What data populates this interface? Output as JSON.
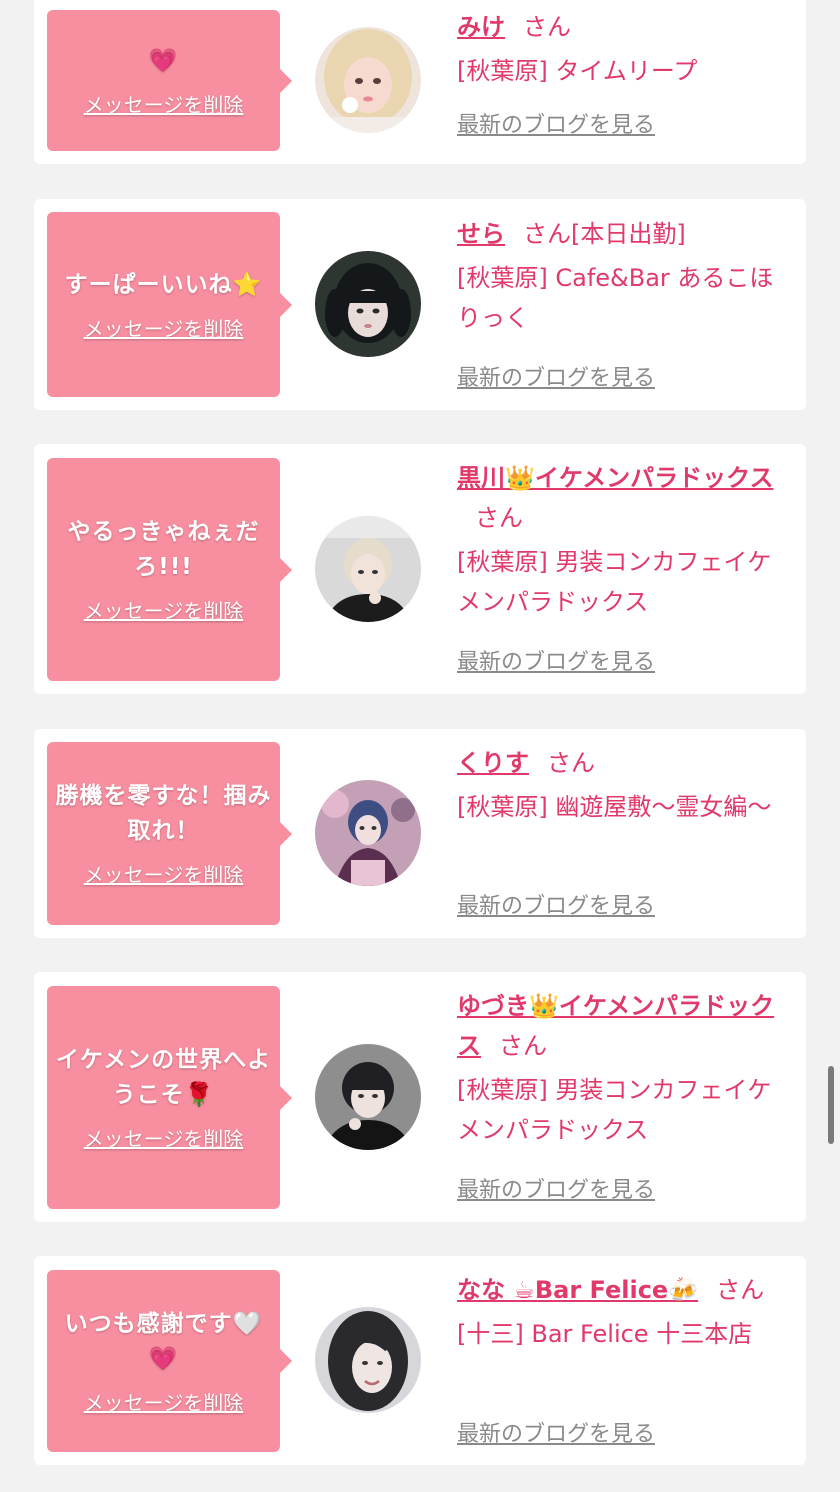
{
  "delete_label": "メッセージを削除",
  "blog_label": "最新のブログを見る",
  "san_label": "さん",
  "colors": {
    "accent": "#e0396a",
    "bubble": "#f88fa0",
    "link_gray": "#8a8a8a",
    "background": "#f2f2f3"
  },
  "items": [
    {
      "message": "💗",
      "name": "みけ",
      "status": "",
      "shop": "[秋葉原] タイムリープ",
      "avatar": "avatar-blonde-girl"
    },
    {
      "message": "すーぱーいいね⭐",
      "name": "せら",
      "status": "[本日出勤]",
      "shop": "[秋葉原] Cafe&Bar あるこほりっく",
      "avatar": "avatar-twin-tails-girl"
    },
    {
      "message": "やるっきゃねぇだろ!!!",
      "name": "黒川👑イケメンパラドックス",
      "status": "",
      "shop": "[秋葉原] 男装コンカフェイケメンパラドックス",
      "avatar": "avatar-blonde-host"
    },
    {
      "message": "勝機を零すな！掴み取れ！",
      "name": "くりす",
      "status": "",
      "shop": "[秋葉原] 幽遊屋敷～霊女編～",
      "avatar": "avatar-blue-hair-girl"
    },
    {
      "message": "イケメンの世界へようこそ🌹",
      "name": "ゆづき👑イケメンパラドックス",
      "status": "",
      "shop": "[秋葉原] 男装コンカフェイケメンパラドックス",
      "avatar": "avatar-short-hair-host"
    },
    {
      "message": "いつも感謝です🤍💗",
      "name": "なな ☕Bar Felice🍻",
      "status": "",
      "shop": "[十三] Bar Felice 十三本店",
      "avatar": "avatar-long-hair-girl"
    }
  ]
}
